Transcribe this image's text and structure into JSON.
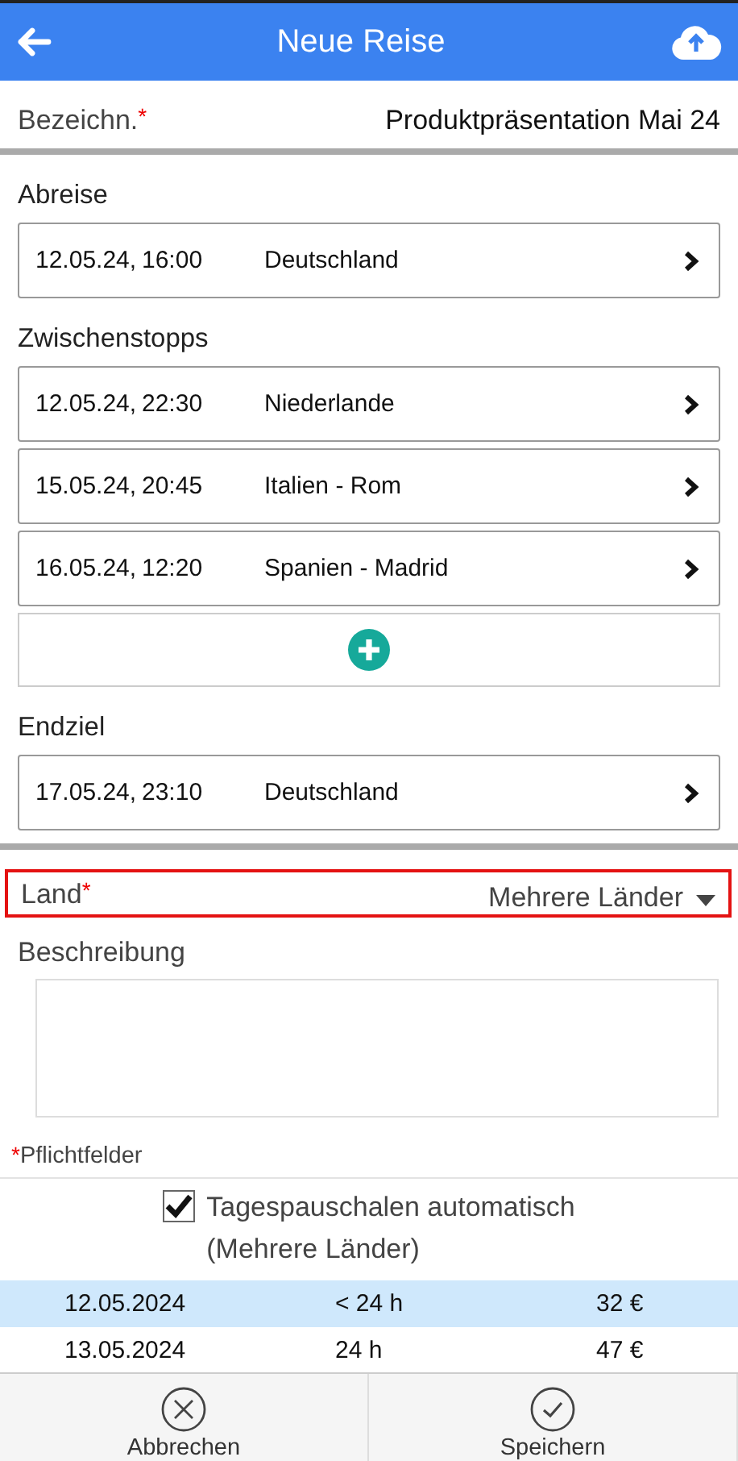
{
  "header": {
    "title": "Neue Reise"
  },
  "name_field": {
    "label": "Bezeichn.",
    "required_mark": "*",
    "value": "Produktpräsentation Mai 24"
  },
  "sections": [
    {
      "title": "Abreise",
      "stops": [
        {
          "date": "12.05.24,",
          "time": "16:00",
          "place": "Deutschland"
        }
      ],
      "add_button": false
    },
    {
      "title": "Zwischenstopps",
      "stops": [
        {
          "date": "12.05.24,",
          "time": "22:30",
          "place": "Niederlande"
        },
        {
          "date": "15.05.24,",
          "time": "20:45",
          "place": "Italien - Rom"
        },
        {
          "date": "16.05.24,",
          "time": "12:20",
          "place": "Spanien - Madrid"
        }
      ],
      "add_button": true
    },
    {
      "title": "Endziel",
      "stops": [
        {
          "date": "17.05.24,",
          "time": "23:10",
          "place": "Deutschland"
        }
      ],
      "add_button": false
    }
  ],
  "country_field": {
    "label": "Land",
    "required_mark": "*",
    "value": "Mehrere Länder",
    "error": true
  },
  "description": {
    "label": "Beschreibung"
  },
  "required_note": {
    "mark": "*",
    "text": "Pflichtfelder"
  },
  "auto_allowance": {
    "checked": true,
    "label": "Tagespauschalen automatisch",
    "sublabel": "(Mehrere Länder)"
  },
  "allowances": [
    {
      "date": "12.05.2024",
      "duration": "< 24 h",
      "amount": "32 €",
      "selected": true
    },
    {
      "date": "13.05.2024",
      "duration": "24 h",
      "amount": "47 €",
      "selected": false
    }
  ],
  "footer": {
    "buttons": [
      {
        "kind": "cancel",
        "label": "Abbrechen"
      },
      {
        "kind": "save",
        "label": "Speichern"
      }
    ]
  }
}
